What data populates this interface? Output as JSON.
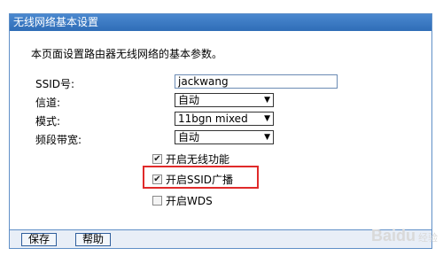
{
  "header": {
    "title": "无线网络基本设置"
  },
  "intro_text": "本页面设置路由器无线网络的基本参数。",
  "form": {
    "ssid": {
      "label": "SSID号:",
      "value": "jackwang"
    },
    "channel": {
      "label": "信道:",
      "value": "自动"
    },
    "mode": {
      "label": "模式:",
      "value": "11bgn mixed"
    },
    "bandwidth": {
      "label": "频段带宽:",
      "value": "自动"
    },
    "enable_wireless": {
      "label": "开启无线功能",
      "checked": true
    },
    "enable_ssid_broadcast": {
      "label": "开启SSID广播",
      "checked": true
    },
    "enable_wds": {
      "label": "开启WDS",
      "checked": false
    }
  },
  "footer": {
    "save_label": "保存",
    "help_label": "帮助"
  },
  "watermark": {
    "text": "Baidu",
    "sub": "经验"
  },
  "colors": {
    "title_bar": "#3a78c2",
    "highlight": "#e02a2a",
    "border": "#5f8fc7"
  }
}
